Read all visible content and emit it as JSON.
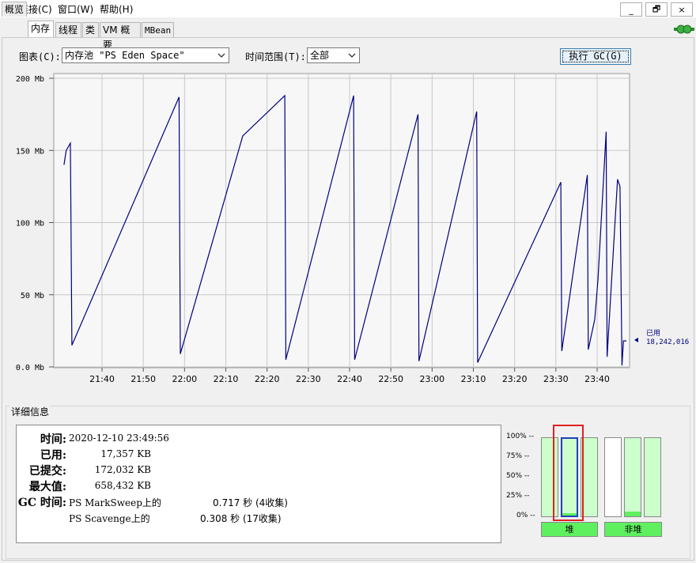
{
  "menu": {
    "connection": "连接(C)",
    "window": "窗口(W)",
    "help": "帮助(H)",
    "minimize": "_",
    "restore": "🗗",
    "close": "×"
  },
  "tabs": [
    "概览",
    "内存",
    "线程",
    "类",
    "VM 概要",
    "MBean"
  ],
  "controls": {
    "chart_label": "图表(C):",
    "chart_value": "内存池 \"PS Eden Space\"",
    "range_label": "时间范围(T):",
    "range_value": "全部",
    "gc_button": "执行 GC(G)"
  },
  "chart_data": {
    "type": "line",
    "ylim": [
      0,
      200
    ],
    "y_ticks": [
      "200 Mb",
      "150 Mb",
      "100 Mb",
      "50 Mb",
      "0.0 Mb"
    ],
    "x_ticks": [
      "21:40",
      "21:50",
      "22:00",
      "22:10",
      "22:20",
      "22:30",
      "22:40",
      "22:50",
      "23:00",
      "23:10",
      "23:20",
      "23:30",
      "23:40"
    ],
    "series": [
      {
        "name": "已用",
        "color": "#000080",
        "points": [
          [
            21.513,
            140
          ],
          [
            21.522,
            150
          ],
          [
            21.539,
            155
          ],
          [
            21.545,
            15
          ],
          [
            21.978,
            187
          ],
          [
            21.983,
            9
          ],
          [
            22.235,
            160
          ],
          [
            22.405,
            188
          ],
          [
            22.409,
            5
          ],
          [
            22.683,
            188
          ],
          [
            22.687,
            5
          ],
          [
            22.943,
            175
          ],
          [
            22.947,
            4
          ],
          [
            23.18,
            177
          ],
          [
            23.184,
            3
          ],
          [
            23.52,
            128
          ],
          [
            23.524,
            11
          ],
          [
            23.627,
            133
          ],
          [
            23.631,
            12
          ],
          [
            23.657,
            33
          ],
          [
            23.67,
            60
          ],
          [
            23.703,
            163
          ],
          [
            23.707,
            7
          ],
          [
            23.749,
            130
          ],
          [
            23.759,
            125
          ],
          [
            23.767,
            1
          ],
          [
            23.773,
            18
          ],
          [
            23.785,
            18
          ]
        ]
      }
    ],
    "current_label": "已用",
    "current_value": "18,242,016"
  },
  "details": {
    "title": "详细信息",
    "time_label": "时间:",
    "time_value": "2020-12-10 23:49:56",
    "used_label": "已用:",
    "used_value": "17,357 KB",
    "committed_label": "已提交:",
    "committed_value": "172,032 KB",
    "max_label": "最大值:",
    "max_value": "658,432 KB",
    "gc_label": "GC 时间:",
    "gc1_name": "PS MarkSweep上的",
    "gc1_value": "0.717 秒 (4收集)",
    "gc2_name": "PS Scavenge上的",
    "gc2_value": "0.308 秒 (17收集)"
  },
  "pool_chart": {
    "pct_labels": [
      "100% --",
      "75% --",
      "50% --",
      "25% --",
      "0% --"
    ],
    "heap_label": "堆",
    "nonheap_label": "非堆",
    "bars": [
      {
        "name": "heap-1",
        "fill": 0.0,
        "committed": true
      },
      {
        "name": "heap-2",
        "fill": 0.03,
        "committed": true,
        "selected": true
      },
      {
        "name": "heap-3",
        "fill": 0.0,
        "committed": true
      },
      {
        "name": "nonheap-1",
        "fill": 0.0,
        "committed": false
      },
      {
        "name": "nonheap-2",
        "fill": 0.06,
        "committed": true
      },
      {
        "name": "nonheap-3",
        "fill": 0.0,
        "committed": true
      }
    ]
  },
  "colors": {
    "line": "#000080",
    "highlight": "#e02020",
    "bar_fill": "#5ff05f",
    "bar_committed": "#ccffcc"
  }
}
